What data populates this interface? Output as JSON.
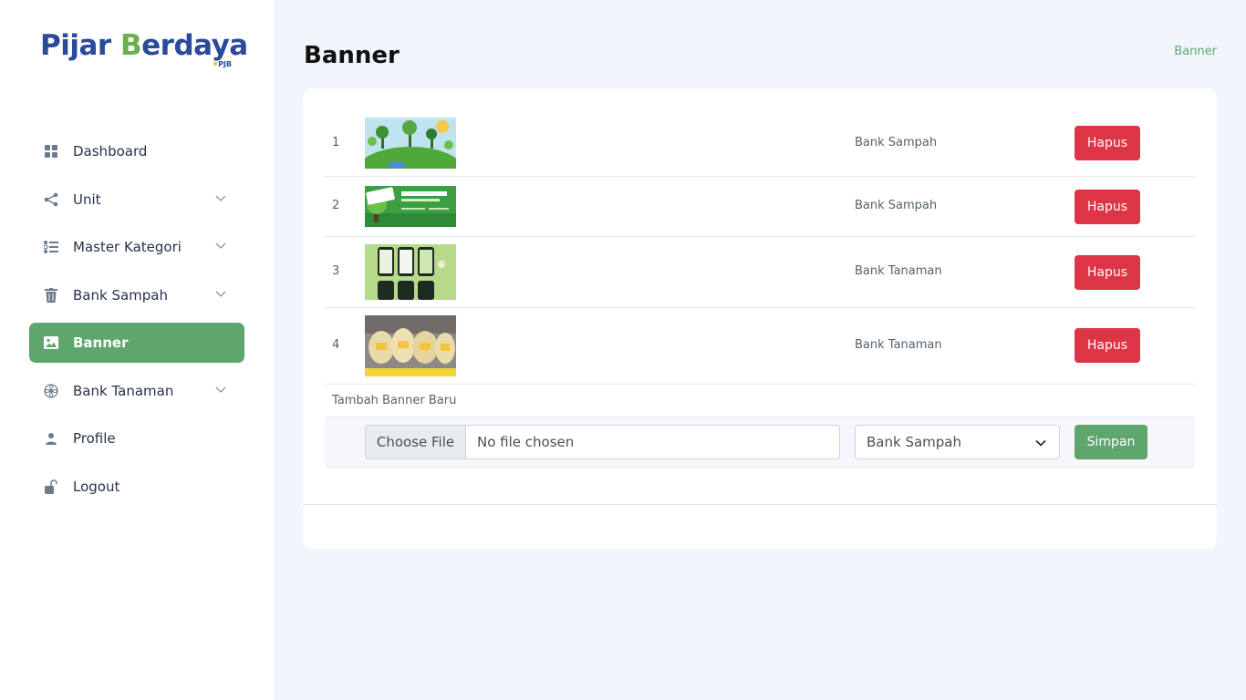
{
  "brand": {
    "name_part1": "Pijar ",
    "name_part2": "B",
    "name_part3": "erdaya",
    "sub": "PJB"
  },
  "sidebar": {
    "items": [
      {
        "label": "Dashboard",
        "icon": "dashboard-icon",
        "expandable": false,
        "active": false
      },
      {
        "label": "Unit",
        "icon": "share-icon",
        "expandable": true,
        "active": false
      },
      {
        "label": "Master Kategori",
        "icon": "list-icon",
        "expandable": true,
        "active": false
      },
      {
        "label": "Bank Sampah",
        "icon": "trash-icon",
        "expandable": true,
        "active": false
      },
      {
        "label": "Banner",
        "icon": "image-icon",
        "expandable": false,
        "active": true
      },
      {
        "label": "Bank Tanaman",
        "icon": "flower-icon",
        "expandable": true,
        "active": false
      },
      {
        "label": "Profile",
        "icon": "user-icon",
        "expandable": false,
        "active": false
      },
      {
        "label": "Logout",
        "icon": "unlock-icon",
        "expandable": false,
        "active": false
      }
    ]
  },
  "header": {
    "title": "Banner",
    "breadcrumb": "Banner"
  },
  "table": {
    "rows": [
      {
        "no": "1",
        "category": "Bank Sampah",
        "action": "Hapus",
        "thumb": "green-earth-thumbnail"
      },
      {
        "no": "2",
        "category": "Bank Sampah",
        "action": "Hapus",
        "thumb": "go-green-banner-thumbnail"
      },
      {
        "no": "3",
        "category": "Bank Tanaman",
        "action": "Hapus",
        "thumb": "app-screens-thumbnail"
      },
      {
        "no": "4",
        "category": "Bank Tanaman",
        "action": "Hapus",
        "thumb": "packaged-goods-thumbnail"
      }
    ]
  },
  "form": {
    "section_label": "Tambah Banner Baru",
    "file_button": "Choose File",
    "file_status": "No file chosen",
    "category_selected": "Bank Sampah",
    "save_label": "Simpan"
  },
  "colors": {
    "accent": "#5ea66c",
    "danger": "#dc3545",
    "brand_blue": "#2a4a9b",
    "background": "#f1f5fc"
  }
}
